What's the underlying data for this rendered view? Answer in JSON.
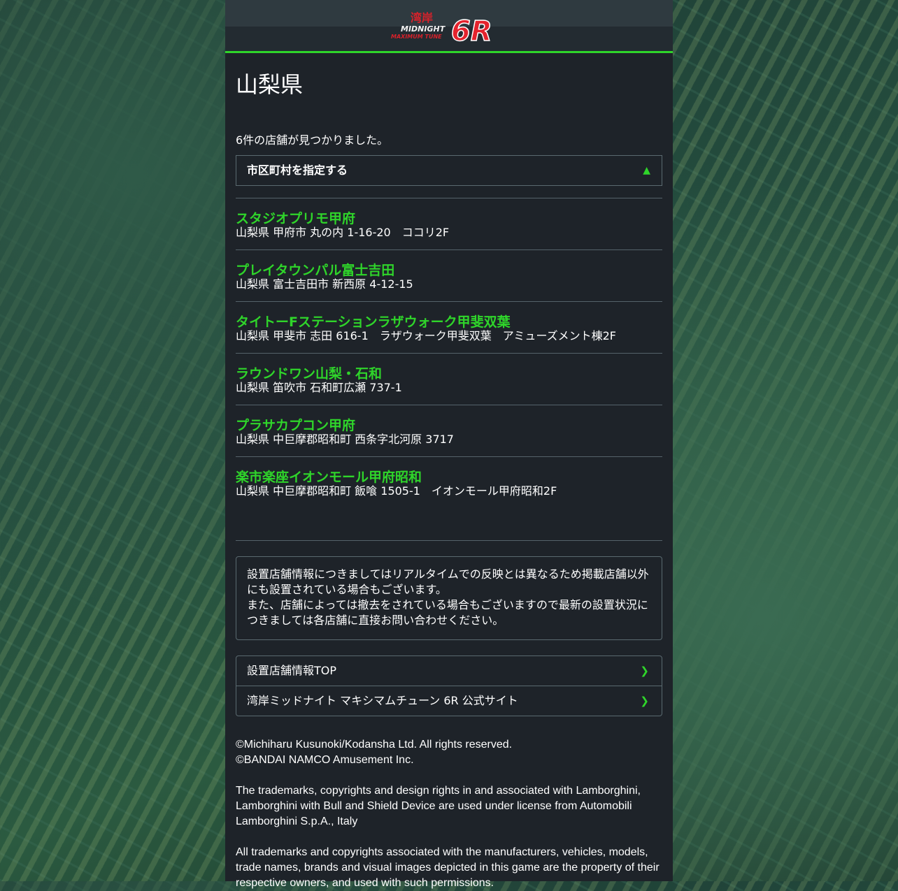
{
  "header": {
    "logo_text_top": "湾岸",
    "logo_text_mid": "MIDNIGHT",
    "logo_text_bottom": "MAXIMUM TUNE",
    "logo_mark": "6R"
  },
  "page": {
    "title": "山梨県",
    "result_count": "6件の店舗が見つかりました。",
    "filter_label": "市区町村を指定する"
  },
  "stores": [
    {
      "name": "スタジオプリモ甲府",
      "address": "山梨県 甲府市 丸の内 1-16-20　ココリ2F"
    },
    {
      "name": "プレイタウンパル富士吉田",
      "address": "山梨県 富士吉田市 新西原 4-12-15"
    },
    {
      "name": "タイトーFステーションラザウォーク甲斐双葉",
      "address": "山梨県 甲斐市 志田 616-1　ラザウォーク甲斐双葉　アミューズメント棟2F"
    },
    {
      "name": "ラウンドワン山梨・石和",
      "address": "山梨県 笛吹市 石和町広瀬 737-1"
    },
    {
      "name": "プラサカプコン甲府",
      "address": "山梨県 中巨摩郡昭和町 西条字北河原 3717"
    },
    {
      "name": "楽市楽座イオンモール甲府昭和",
      "address": "山梨県 中巨摩郡昭和町 飯喰 1505-1　イオンモール甲府昭和2F"
    }
  ],
  "notice": {
    "line1": "設置店舗情報につきましてはリアルタイムでの反映とは異なるため掲載店舗以外にも設置されている場合もございます。",
    "line2": "また、店舗によっては撤去をされている場合もございますので最新の設置状況につきましては各店舗に直接お問い合わせください。"
  },
  "links": [
    {
      "label": "設置店舗情報TOP"
    },
    {
      "label": "湾岸ミッドナイト マキシマムチューン 6R 公式サイト"
    }
  ],
  "footer": {
    "copyright1": "©Michiharu Kusunoki/Kodansha Ltd. All rights reserved.",
    "copyright2": "©BANDAI NAMCO Amusement Inc.",
    "lamborghini": "The trademarks, copyrights and design rights in and associated with Lamborghini, Lamborghini with Bull and Shield Device are used under license from Automobili Lamborghini S.p.A., Italy",
    "trademarks": "All trademarks and copyrights associated with the manufacturers, vehicles, models, trade names, brands and visual images depicted in this game are the property of their respective owners, and used with such permissions."
  },
  "colors": {
    "accent": "#2fd52a",
    "panel_bg": "#1e2329",
    "border": "#5a6a70"
  }
}
